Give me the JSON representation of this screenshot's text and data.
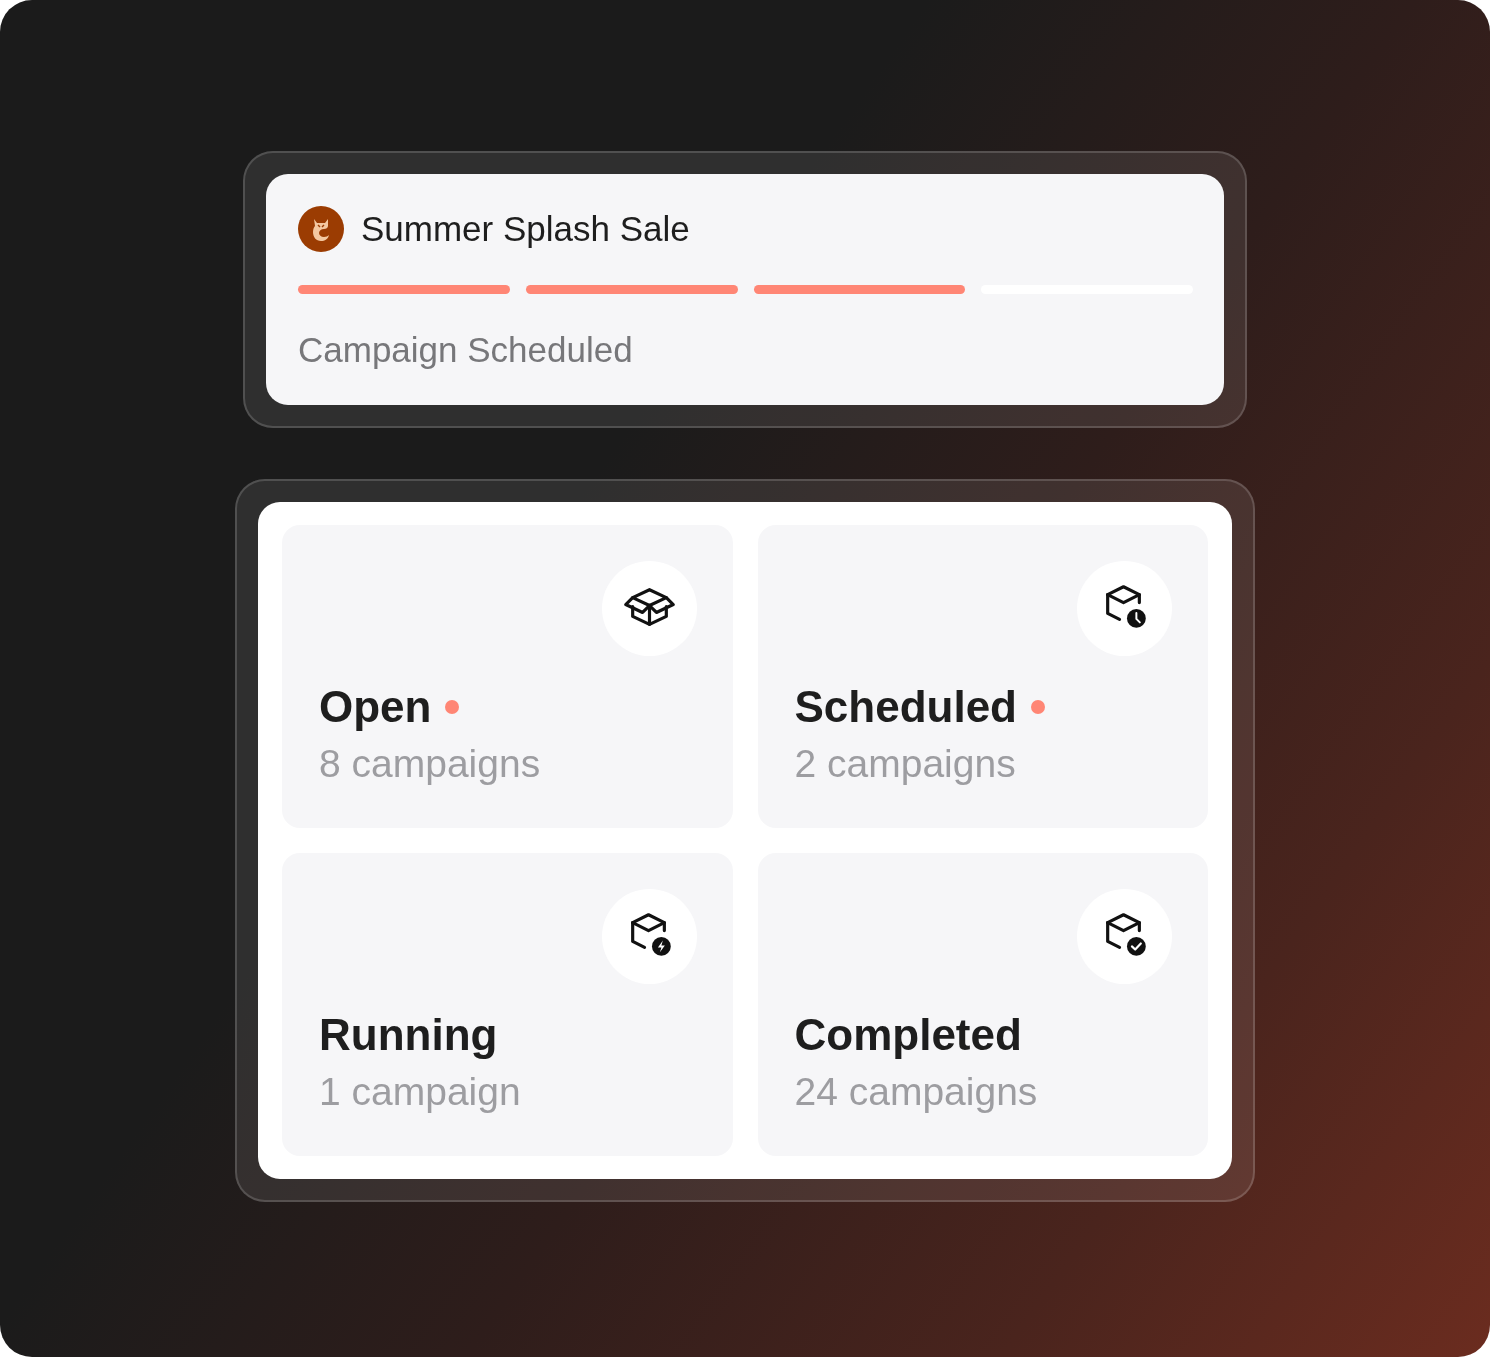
{
  "campaign": {
    "title": "Summer Splash Sale",
    "progress": [
      {
        "completed": true
      },
      {
        "completed": true
      },
      {
        "completed": true
      },
      {
        "completed": false
      }
    ],
    "status": "Campaign Scheduled"
  },
  "tiles": [
    {
      "kind": "open",
      "title": "Open",
      "attention": true,
      "count": "8 campaigns"
    },
    {
      "kind": "scheduled",
      "title": "Scheduled",
      "attention": true,
      "count": "2 campaigns"
    },
    {
      "kind": "running",
      "title": "Running",
      "attention": false,
      "count": "1 campaign"
    },
    {
      "kind": "completed",
      "title": "Completed",
      "attention": false,
      "count": "24 campaigns"
    }
  ]
}
